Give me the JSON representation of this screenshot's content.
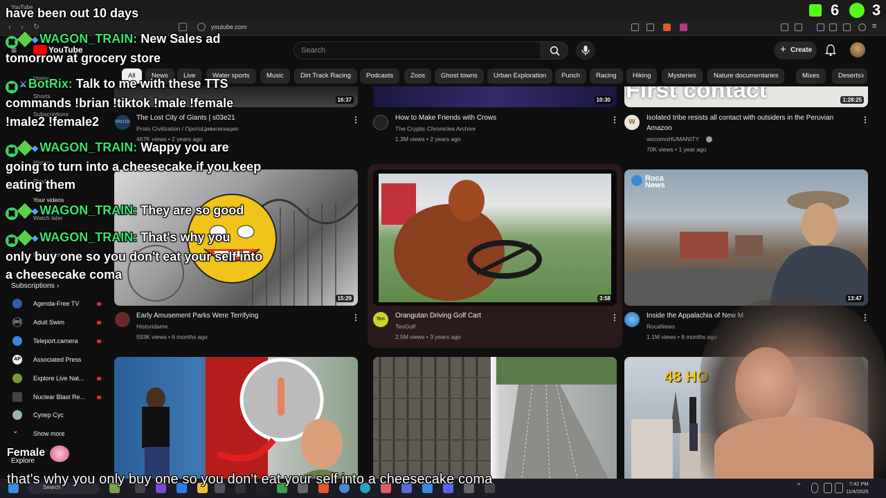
{
  "browser": {
    "tab_title": "YouTube",
    "url": "youtube.com"
  },
  "header": {
    "logo": "YouTube",
    "search_placeholder": "Search",
    "create_label": "Create"
  },
  "chips": [
    "All",
    "News",
    "Live",
    "Water sports",
    "Music",
    "Dirt Track Racing",
    "Podcasts",
    "Zoos",
    "Ghost towns",
    "Urban Exploration",
    "Punch",
    "Racing",
    "Hiking",
    "Mysteries",
    "Nature documentaries",
    "Mixes",
    "Deserts"
  ],
  "sidebar": {
    "faint_items": [
      "Home",
      "Shorts",
      "Subscriptions",
      "History",
      "Playlists",
      "Your videos",
      "Watch later",
      "Liked videos"
    ],
    "subscriptions_heading": "Subscriptions",
    "subscriptions": [
      {
        "label": "Agenda-Free TV",
        "color": "#2e5ea8"
      },
      {
        "label": "Adult Swim",
        "color": "#111111"
      },
      {
        "label": "Teleport.camera",
        "color": "#3a8bd6"
      },
      {
        "label": "Associated Press",
        "color": "#f1f1f1"
      },
      {
        "label": "Explore Live Nat...",
        "color": "#7a9a3a"
      },
      {
        "label": "Nuclear Blast Re...",
        "color": "#444444"
      },
      {
        "label": "Супер Сус",
        "color": "#9ab8a8"
      }
    ],
    "show_more": "Show more",
    "explore": "Explore"
  },
  "videos": [
    {
      "title": "The Lost City of Giants | s03e21",
      "channel": "Proto Civilization / ПротоЦивилизация",
      "meta": "467K views • 2 years ago",
      "duration": "16:37"
    },
    {
      "title": "How to Make Friends with Crows",
      "channel": "The Cryptic Chronicles Archive",
      "meta": "1.3M views • 2 years ago",
      "duration": "10:30"
    },
    {
      "title": "Isolated tribe resists all contact with outsiders in the Peruvian",
      "title2": "Amazon",
      "channel": "wocomoHUMANITY",
      "meta": "70K views • 1 year ago",
      "duration": "1:28:25",
      "thumb_text": "First contact"
    },
    {
      "title": "Early Amusement Parks Were Terrifying",
      "channel": "Historidame",
      "meta": "593K views • 6 months ago",
      "duration": "15:29"
    },
    {
      "title": "Orangutan Driving Golf Cart",
      "channel": "TenGolf",
      "meta": "2.5M views • 3 years ago",
      "duration": "3:58"
    },
    {
      "title": "Inside the Appalachia of New M",
      "channel": "RocaNews",
      "meta": "1.1M views • 8 months ago",
      "duration": "13:47",
      "thumb_text": "Roca News"
    },
    {
      "title": "",
      "channel": "",
      "meta": "",
      "duration": ""
    },
    {
      "title": "",
      "channel": "",
      "meta": "",
      "duration": ""
    },
    {
      "title": "",
      "channel": "",
      "meta": "",
      "duration": "",
      "thumb_text": "48 HO"
    }
  ],
  "chat": [
    {
      "user": "",
      "text": "have been out 10 days"
    },
    {
      "user": "WAGON_TRAIN:",
      "text": "New Sales ad"
    },
    {
      "user": "",
      "text": "tomorrow at grocery store"
    },
    {
      "user": "BotRix:",
      "text": "Talk to me with these TTS"
    },
    {
      "user": "",
      "text": "commands !brian !tiktok !male !female"
    },
    {
      "user": "",
      "text": "!male2 !female2"
    },
    {
      "user": "WAGON_TRAIN:",
      "text": "Wappy you are"
    },
    {
      "user": "",
      "text": "going to turn into a cheesecake if you keep"
    },
    {
      "user": "",
      "text": "eating them"
    },
    {
      "user": "WAGON_TRAIN:",
      "text": "They are so good"
    },
    {
      "user": "WAGON_TRAIN:",
      "text": "That's why you"
    },
    {
      "user": "",
      "text": "only buy one so you don't eat your self into"
    },
    {
      "user": "",
      "text": "a cheesecake coma"
    }
  ],
  "stats": {
    "kick_count": "6",
    "play_count": "3"
  },
  "tts_voice": "Female",
  "caption": "that's why you only buy one so you don't eat your self into a cheesecake coma",
  "taskbar": {
    "search": "Search",
    "time": "7:42 PM",
    "date": "11/4/2025"
  }
}
